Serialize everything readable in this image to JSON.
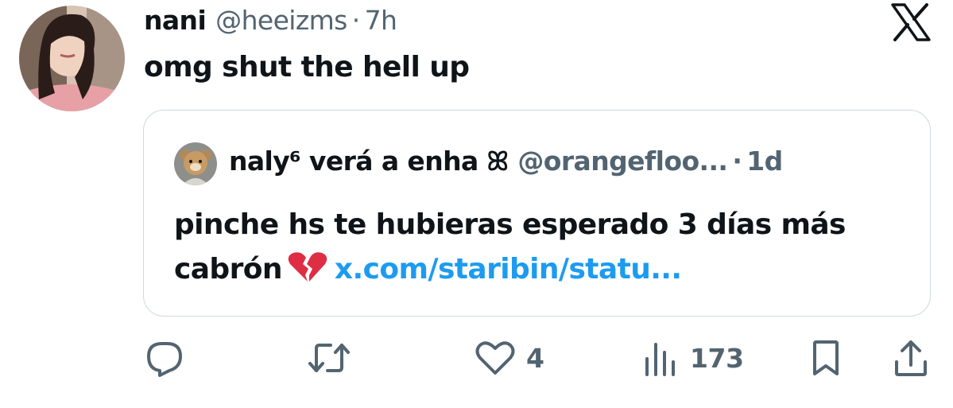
{
  "tweet": {
    "author_name": "nani",
    "handle": "@heeizms",
    "separator": "·",
    "time": "7h",
    "text": "omg shut the hell up"
  },
  "quote": {
    "author_name": "naly⁶ verá a enha ꕤ",
    "handle": "@orangefloo...",
    "separator": "·",
    "time": "1d",
    "text_line1": "pinche hs te hubieras esperado 3 días más",
    "text_line2": "cabrón",
    "link": "x.com/staribin/statu..."
  },
  "actions": {
    "likes": "4",
    "views": "173"
  },
  "colors": {
    "text": "#0f1419",
    "secondary": "#536471",
    "link": "#1d9bf0",
    "border": "#cfd9de",
    "broken_heart": "#dd2e44"
  },
  "icons": [
    "x-logo-icon",
    "reply-icon",
    "retweet-icon",
    "like-icon",
    "views-icon",
    "bookmark-icon",
    "share-icon",
    "broken-heart-emoji"
  ]
}
